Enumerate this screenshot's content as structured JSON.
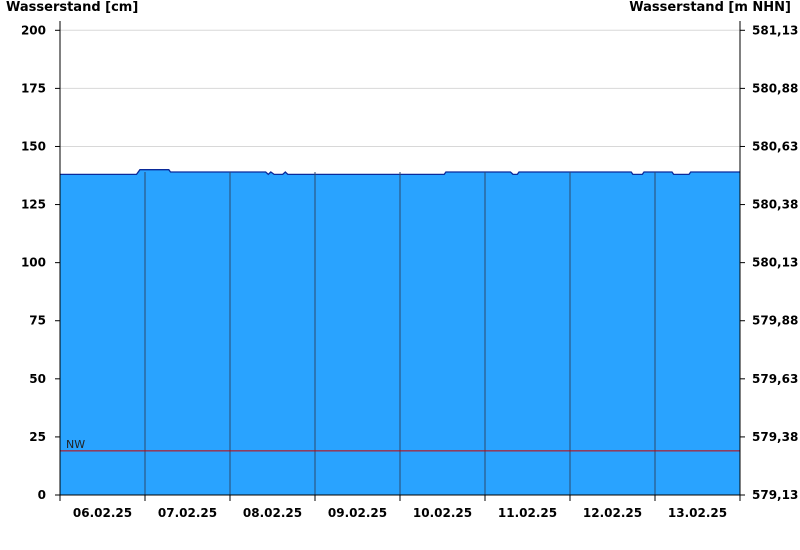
{
  "chart_data": {
    "type": "area",
    "title": "",
    "ylabel_left": "Wasserstand [cm]",
    "ylabel_right": "Wasserstand [m NHN]",
    "ylim": [
      0,
      204
    ],
    "grid": true,
    "y_ticks_left": [
      "0",
      "25",
      "50",
      "75",
      "100",
      "125",
      "150",
      "175",
      "200"
    ],
    "y_ticks_right": [
      "579,13",
      "579,38",
      "579,63",
      "579,88",
      "580,13",
      "580,38",
      "580,63",
      "580,88",
      "581,13"
    ],
    "x_day_labels": [
      "06.02.25",
      "07.02.25",
      "08.02.25",
      "09.02.25",
      "10.02.25",
      "11.02.25",
      "12.02.25",
      "13.02.25"
    ],
    "x_days": 8,
    "series": [
      {
        "values": [
          {
            "t": 0.0,
            "v": 138
          },
          {
            "t": 0.9,
            "v": 138
          },
          {
            "t": 0.94,
            "v": 140
          },
          {
            "t": 1.28,
            "v": 140
          },
          {
            "t": 1.3,
            "v": 139
          },
          {
            "t": 2.42,
            "v": 139
          },
          {
            "t": 2.45,
            "v": 138
          },
          {
            "t": 2.48,
            "v": 139
          },
          {
            "t": 2.52,
            "v": 138
          },
          {
            "t": 2.62,
            "v": 138
          },
          {
            "t": 2.65,
            "v": 139
          },
          {
            "t": 2.68,
            "v": 138
          },
          {
            "t": 4.52,
            "v": 138
          },
          {
            "t": 4.54,
            "v": 139
          },
          {
            "t": 5.3,
            "v": 139
          },
          {
            "t": 5.33,
            "v": 138
          },
          {
            "t": 5.38,
            "v": 138
          },
          {
            "t": 5.4,
            "v": 139
          },
          {
            "t": 6.72,
            "v": 139
          },
          {
            "t": 6.74,
            "v": 138
          },
          {
            "t": 6.85,
            "v": 138
          },
          {
            "t": 6.87,
            "v": 139
          },
          {
            "t": 7.2,
            "v": 139
          },
          {
            "t": 7.22,
            "v": 138
          },
          {
            "t": 7.4,
            "v": 138
          },
          {
            "t": 7.42,
            "v": 139
          },
          {
            "t": 8.0,
            "v": 139
          }
        ]
      }
    ],
    "reference_lines": [
      {
        "label": "NW",
        "value": 19,
        "color": "#cc0000"
      }
    ],
    "colors": {
      "fill": "#29a3ff",
      "line": "#0a2a9a",
      "day_divider": "#2c4a6e",
      "grid": "#d8d8d8",
      "axis": "#000000"
    }
  }
}
